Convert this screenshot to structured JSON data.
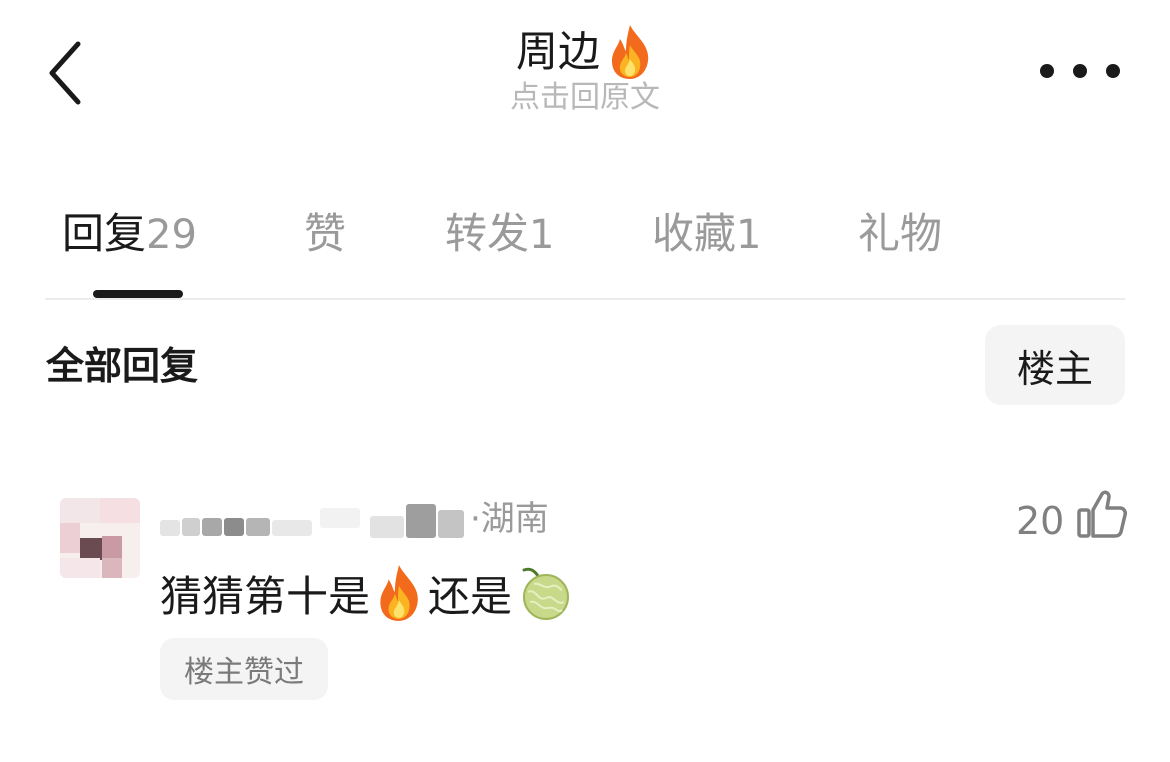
{
  "header": {
    "back_icon": "chevron-left-icon",
    "title": "周边",
    "title_emoji": "fire-emoji",
    "subtitle": "点击回原文",
    "more_icon": "more-horizontal-icon"
  },
  "tabs": [
    {
      "label": "回复",
      "count": "29",
      "active": true
    },
    {
      "label": "赞",
      "count": "",
      "active": false
    },
    {
      "label": "转发",
      "count": "1",
      "active": false
    },
    {
      "label": "收藏",
      "count": "1",
      "active": false
    },
    {
      "label": "礼物",
      "count": "",
      "active": false
    }
  ],
  "section": {
    "title": "全部回复",
    "owner_filter_label": "楼主"
  },
  "comment": {
    "location_suffix": "·湖南",
    "like_count": "20",
    "like_icon": "thumbs-up-icon",
    "text_part1": "猜猜第十是",
    "emoji1": "fire-emoji",
    "text_part2": "还是",
    "emoji2": "melon-emoji",
    "badge": "楼主赞过"
  },
  "colors": {
    "text_primary": "#1a1a1a",
    "text_secondary": "#9a9a9a",
    "chip_bg": "#f4f4f4",
    "divider": "#ececec"
  }
}
